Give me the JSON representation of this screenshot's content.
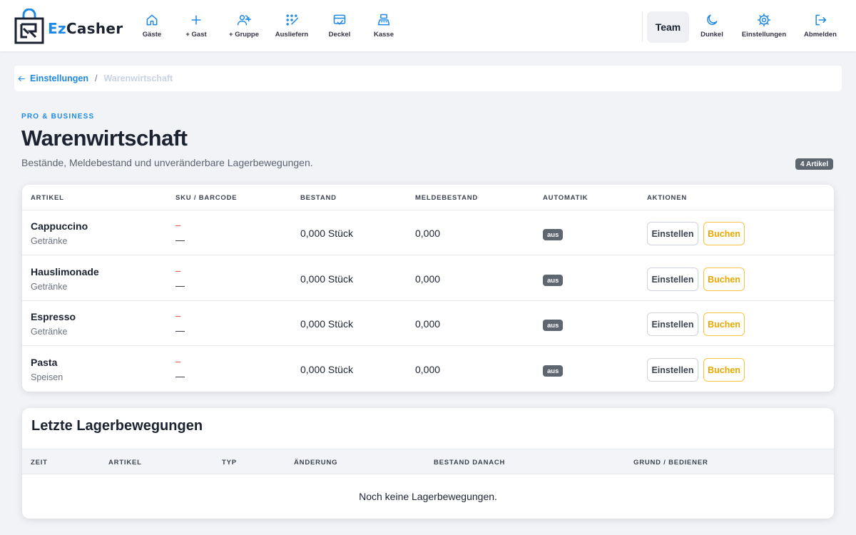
{
  "brand": {
    "prefix": "Ez",
    "rest": "Casher"
  },
  "nav": {
    "items": [
      {
        "label": "Gäste",
        "icon": "home-icon"
      },
      {
        "label": "+ Gast",
        "icon": "plus-icon"
      },
      {
        "label": "+ Gruppe",
        "icon": "add-group-icon"
      },
      {
        "label": "Ausliefern",
        "icon": "deliver-grid-icon"
      },
      {
        "label": "Deckel",
        "icon": "card-check-icon"
      },
      {
        "label": "Kasse",
        "icon": "cash-register-icon"
      }
    ],
    "team_label": "Team",
    "right_items": [
      {
        "label": "Dunkel",
        "icon": "moon-icon"
      },
      {
        "label": "Einstellungen",
        "icon": "gear-icon"
      },
      {
        "label": "Abmelden",
        "icon": "logout-icon"
      }
    ]
  },
  "breadcrumb": {
    "back_label": "Einstellungen",
    "separator": "/",
    "current": "Warenwirtschaft"
  },
  "header": {
    "eyebrow": "PRO & BUSINESS",
    "title": "Warenwirtschaft",
    "subtitle": "Bestände, Meldebestand und unveränderbare Lagerbewegungen.",
    "count_badge": "4 Artikel"
  },
  "stock_table": {
    "columns": [
      "ARTIKEL",
      "SKU / BARCODE",
      "BESTAND",
      "MELDEBESTAND",
      "AUTOMATIK",
      "AKTIONEN"
    ],
    "rows": [
      {
        "name": "Cappuccino",
        "category": "Getränke",
        "sku": "–",
        "barcode": "—",
        "stock": "0,000 Stück",
        "min_stock": "0,000",
        "auto": "aus",
        "btn_settings": "Einstellen",
        "btn_book": "Buchen"
      },
      {
        "name": "Hauslimonade",
        "category": "Getränke",
        "sku": "–",
        "barcode": "—",
        "stock": "0,000 Stück",
        "min_stock": "0,000",
        "auto": "aus",
        "btn_settings": "Einstellen",
        "btn_book": "Buchen"
      },
      {
        "name": "Espresso",
        "category": "Getränke",
        "sku": "–",
        "barcode": "—",
        "stock": "0,000 Stück",
        "min_stock": "0,000",
        "auto": "aus",
        "btn_settings": "Einstellen",
        "btn_book": "Buchen"
      },
      {
        "name": "Pasta",
        "category": "Speisen",
        "sku": "–",
        "barcode": "—",
        "stock": "0,000 Stück",
        "min_stock": "0,000",
        "auto": "aus",
        "btn_settings": "Einstellen",
        "btn_book": "Buchen"
      }
    ]
  },
  "moves": {
    "title": "Letzte Lagerbewegungen",
    "columns": [
      "ZEIT",
      "ARTIKEL",
      "TYP",
      "ÄNDERUNG",
      "BESTAND DANACH",
      "GRUND / BEDIENER"
    ],
    "empty_message": "Noch keine Lagerbewegungen."
  },
  "colors": {
    "accent": "#1e88e5",
    "book_button": "#e8a800",
    "badge": "#5e6670",
    "sku_dash": "#e53935"
  }
}
